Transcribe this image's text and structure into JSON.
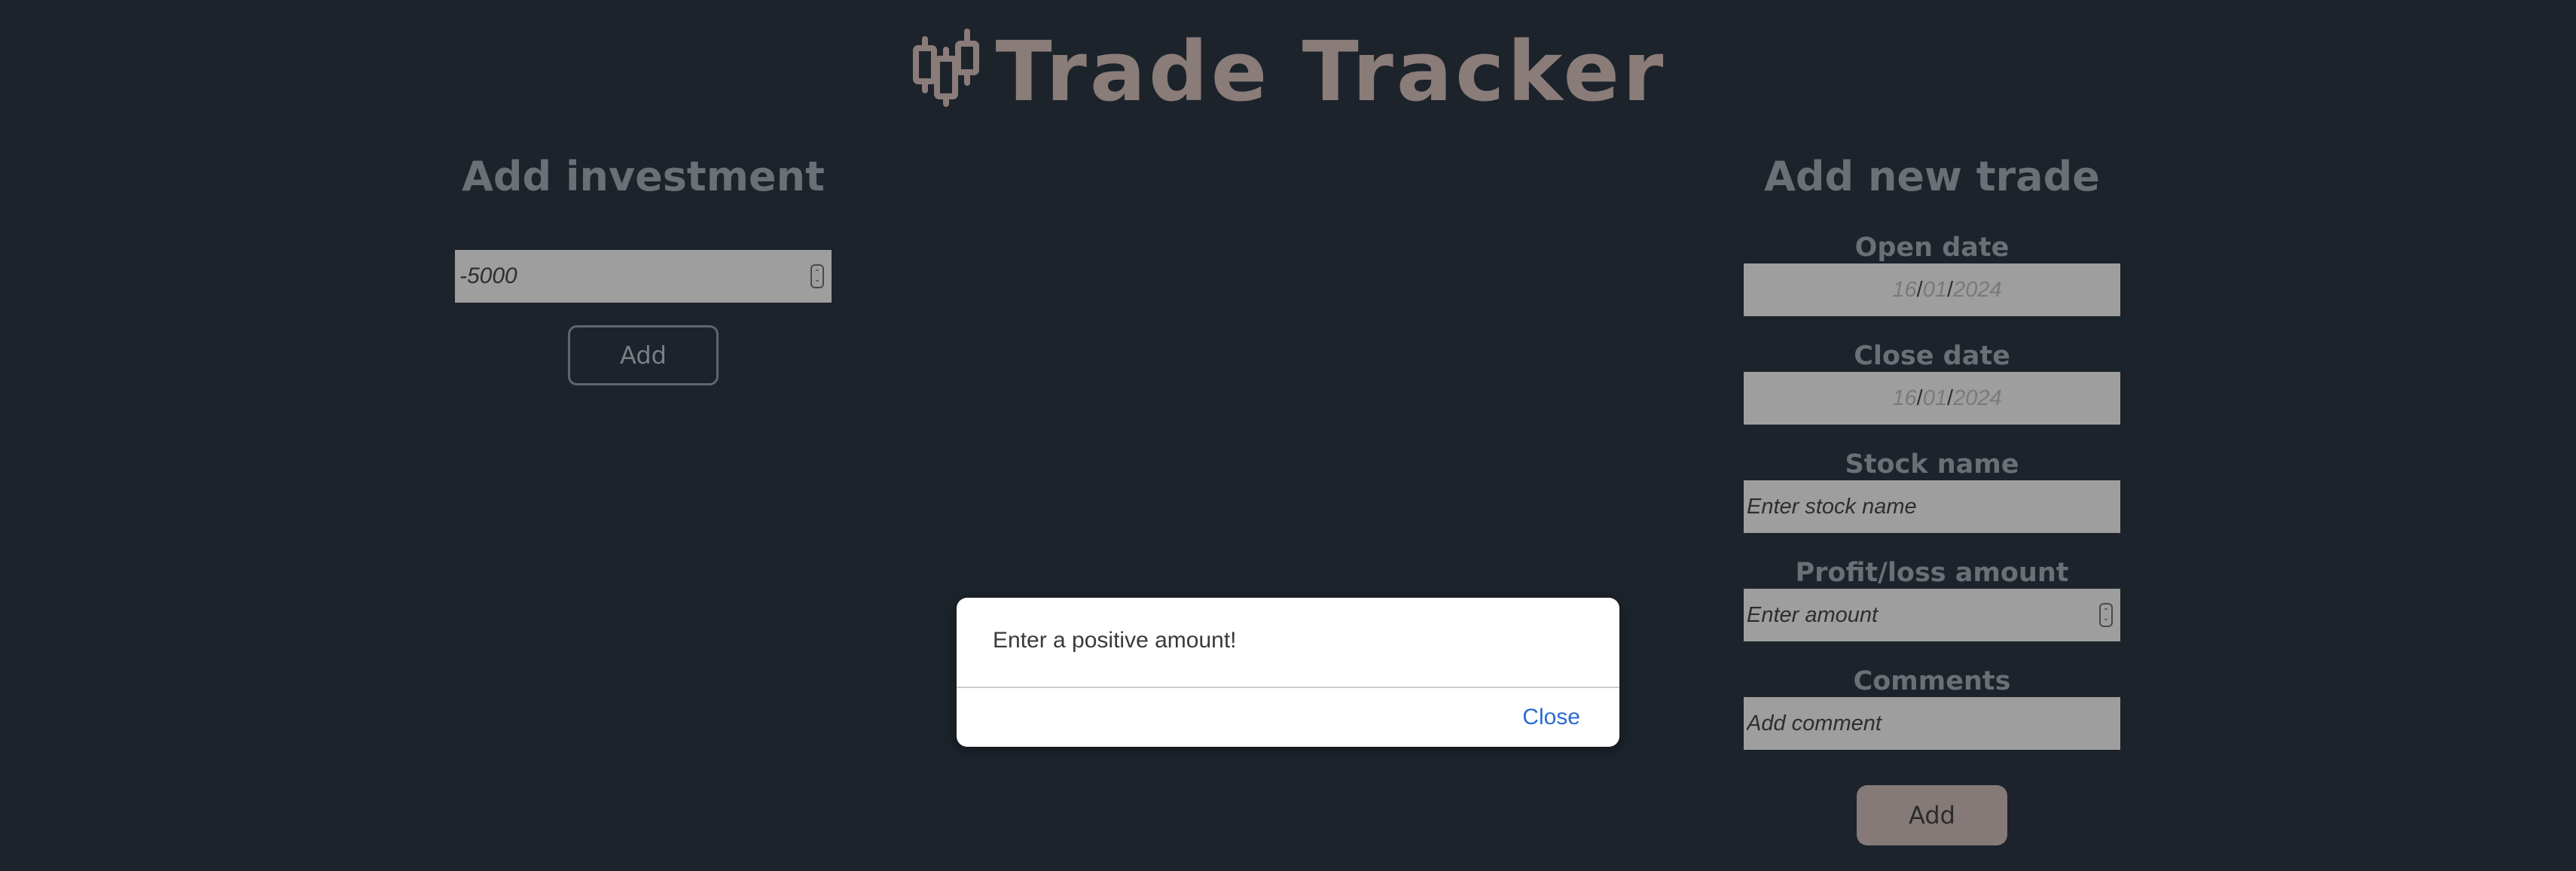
{
  "header": {
    "title": "Trade Tracker",
    "icon": "candlestick-icon",
    "title_color": "#8a7c79"
  },
  "investment": {
    "title": "Add investment",
    "amount_value": "-5000",
    "add_label": "Add"
  },
  "trade": {
    "title": "Add new trade",
    "open_date_label": "Open date",
    "open_date": {
      "day": "16",
      "month": "01",
      "year": "2024"
    },
    "close_date_label": "Close date",
    "close_date": {
      "day": "16",
      "month": "01",
      "year": "2024"
    },
    "stock_label": "Stock name",
    "stock_placeholder": "Enter stock name",
    "amount_label": "Profit/loss amount",
    "amount_placeholder": "Enter amount",
    "comments_label": "Comments",
    "comments_placeholder": "Add comment",
    "add_label": "Add"
  },
  "dialog": {
    "message": "Enter a positive amount!",
    "close_label": "Close",
    "link_color": "#2a6bd1"
  },
  "colors": {
    "background": "#1d232b",
    "field_background": "#9e9e9e",
    "label": "#6b6f76",
    "primary_button": "#857a78"
  }
}
